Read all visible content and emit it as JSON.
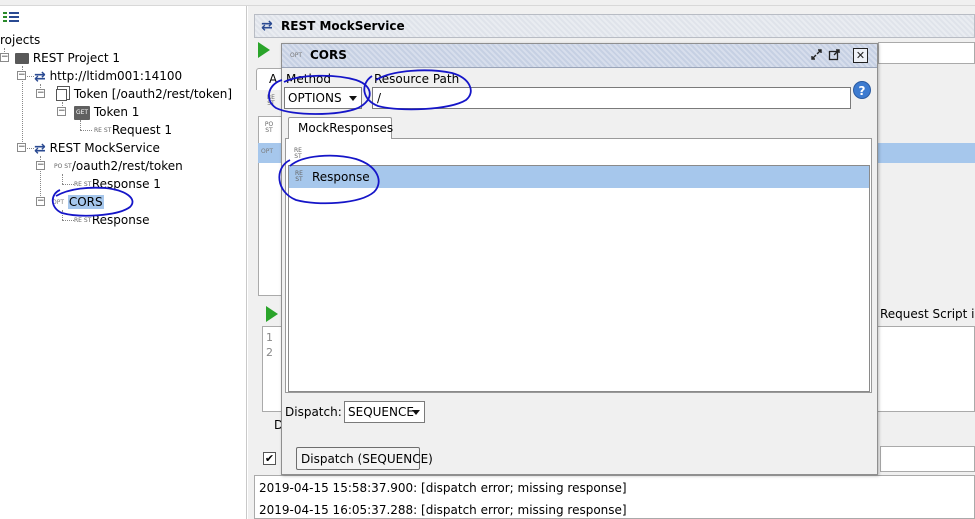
{
  "navigator": {
    "root_label": "rojects",
    "project": "REST Project 1",
    "service_host": "http://ltidm001:14100",
    "token_resource": "Token [/oauth2/rest/token]",
    "token_method_badge": "GET",
    "token_method": "Token 1",
    "request": "Request 1",
    "mock_service": "REST MockService",
    "post_action": "/oauth2/rest/token",
    "post_response": "Response 1",
    "cors_action": "CORS",
    "cors_response": "Response",
    "rest_icon_text": "RE ST",
    "post_icon_text": "PO ST",
    "opt_icon_text": "OPT"
  },
  "main": {
    "title": "REST MockService",
    "tab_fragment": "A",
    "script_notice": "Request Script is i",
    "line_numbers": [
      "1",
      "2"
    ],
    "bottom_label": "D",
    "log_lines": [
      "2019-04-15 15:58:37.900: [dispatch error; missing response]",
      "2019-04-15 16:05:37.288: [dispatch error; missing response]"
    ]
  },
  "cors_window": {
    "title": "CORS",
    "title_icon": "OPT",
    "method_label": "Method",
    "method_value": "OPTIONS",
    "resource_path_label": "Resource Path",
    "resource_path_value": "/",
    "help_symbol": "?",
    "tab_label": "MockResponses",
    "response_item": "Response",
    "dispatch_label": "Dispatch:",
    "dispatch_value": "SEQUENCE",
    "dispatch_button": "Dispatch (SEQUENCE)"
  },
  "colors": {
    "selection": "#a6c7ec",
    "annotation_ink": "#1515c8",
    "run_green": "#2aa42a"
  }
}
